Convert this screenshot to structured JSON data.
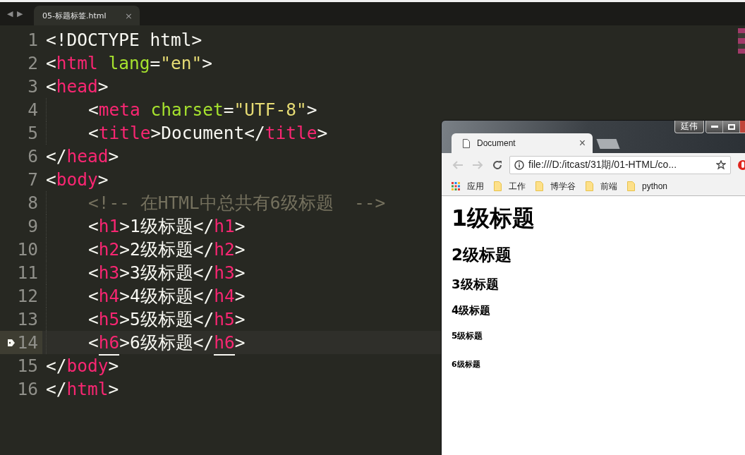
{
  "editor": {
    "nav": [
      "◀",
      "▶"
    ],
    "tabs": [
      {
        "label": "05-标题标签.html",
        "selected": true,
        "close": "×"
      }
    ],
    "lines": [
      {
        "number": "1",
        "indent": false,
        "current": false,
        "tokens": [
          {
            "t": "<!DOCTYPE html>",
            "kind": "text"
          }
        ]
      },
      {
        "number": "2",
        "indent": false,
        "current": false,
        "tokens": [
          {
            "t": "<",
            "kind": "text"
          },
          {
            "t": "html",
            "kind": "tag"
          },
          {
            "t": " lang",
            "kind": "attr"
          },
          {
            "t": "=",
            "kind": "text"
          },
          {
            "t": "\"en\"",
            "kind": "string"
          },
          {
            "t": ">",
            "kind": "text"
          }
        ]
      },
      {
        "number": "3",
        "indent": false,
        "current": false,
        "tokens": [
          {
            "t": "<",
            "kind": "text"
          },
          {
            "t": "head",
            "kind": "tag"
          },
          {
            "t": ">",
            "kind": "text"
          }
        ]
      },
      {
        "number": "4",
        "indent": true,
        "current": false,
        "tokens": [
          {
            "t": "<",
            "kind": "text"
          },
          {
            "t": "meta",
            "kind": "tag"
          },
          {
            "t": " charset",
            "kind": "attr"
          },
          {
            "t": "=",
            "kind": "text"
          },
          {
            "t": "\"UTF-8\"",
            "kind": "string"
          },
          {
            "t": ">",
            "kind": "text"
          }
        ]
      },
      {
        "number": "5",
        "indent": true,
        "current": false,
        "tokens": [
          {
            "t": "<",
            "kind": "text"
          },
          {
            "t": "title",
            "kind": "tag"
          },
          {
            "t": ">Document</",
            "kind": "text"
          },
          {
            "t": "title",
            "kind": "tag"
          },
          {
            "t": ">",
            "kind": "text"
          }
        ]
      },
      {
        "number": "6",
        "indent": false,
        "current": false,
        "tokens": [
          {
            "t": "</",
            "kind": "text"
          },
          {
            "t": "head",
            "kind": "tag"
          },
          {
            "t": ">",
            "kind": "text"
          }
        ]
      },
      {
        "number": "7",
        "indent": false,
        "current": false,
        "tokens": [
          {
            "t": "<",
            "kind": "text"
          },
          {
            "t": "body",
            "kind": "tag"
          },
          {
            "t": ">",
            "kind": "text"
          }
        ]
      },
      {
        "number": "8",
        "indent": true,
        "current": false,
        "tokens": [
          {
            "t": "<!-- 在HTML中总共有6级标题  -->",
            "kind": "comment"
          }
        ]
      },
      {
        "number": "9",
        "indent": true,
        "current": false,
        "tokens": [
          {
            "t": "<",
            "kind": "text"
          },
          {
            "t": "h1",
            "kind": "tag"
          },
          {
            "t": ">1级标题</",
            "kind": "text"
          },
          {
            "t": "h1",
            "kind": "tag"
          },
          {
            "t": ">",
            "kind": "text"
          }
        ]
      },
      {
        "number": "10",
        "indent": true,
        "current": false,
        "tokens": [
          {
            "t": "<",
            "kind": "text"
          },
          {
            "t": "h2",
            "kind": "tag"
          },
          {
            "t": ">2级标题</",
            "kind": "text"
          },
          {
            "t": "h2",
            "kind": "tag"
          },
          {
            "t": ">",
            "kind": "text"
          }
        ]
      },
      {
        "number": "11",
        "indent": true,
        "current": false,
        "tokens": [
          {
            "t": "<",
            "kind": "text"
          },
          {
            "t": "h3",
            "kind": "tag"
          },
          {
            "t": ">3级标题</",
            "kind": "text"
          },
          {
            "t": "h3",
            "kind": "tag"
          },
          {
            "t": ">",
            "kind": "text"
          }
        ]
      },
      {
        "number": "12",
        "indent": true,
        "current": false,
        "tokens": [
          {
            "t": "<",
            "kind": "text"
          },
          {
            "t": "h4",
            "kind": "tag"
          },
          {
            "t": ">4级标题</",
            "kind": "text"
          },
          {
            "t": "h4",
            "kind": "tag"
          },
          {
            "t": ">",
            "kind": "text"
          }
        ]
      },
      {
        "number": "13",
        "indent": true,
        "current": false,
        "tokens": [
          {
            "t": "<",
            "kind": "text"
          },
          {
            "t": "h5",
            "kind": "tag"
          },
          {
            "t": ">5级标题</",
            "kind": "text"
          },
          {
            "t": "h5",
            "kind": "tag"
          },
          {
            "t": ">",
            "kind": "text"
          }
        ]
      },
      {
        "number": "14",
        "indent": true,
        "current": true,
        "tokens": [
          {
            "t": "<",
            "kind": "text"
          },
          {
            "t": "h6",
            "kind": "matched"
          },
          {
            "t": ">6级标题</",
            "kind": "text"
          },
          {
            "t": "h6",
            "kind": "matched"
          },
          {
            "t": ">",
            "kind": "text"
          }
        ]
      },
      {
        "number": "15",
        "indent": false,
        "current": false,
        "tokens": [
          {
            "t": "</",
            "kind": "text"
          },
          {
            "t": "body",
            "kind": "tag"
          },
          {
            "t": ">",
            "kind": "text"
          }
        ]
      },
      {
        "number": "16",
        "indent": false,
        "current": false,
        "tokens": [
          {
            "t": "</",
            "kind": "text"
          },
          {
            "t": "html",
            "kind": "tag"
          },
          {
            "t": ">",
            "kind": "text"
          }
        ]
      }
    ]
  },
  "browser": {
    "user_badge": "廷伟",
    "tabs": [
      {
        "title": "Document",
        "selected": true,
        "close": "×"
      }
    ],
    "address": "file:///D:/itcast/31期/01-HTML/co...",
    "bookmarks": [
      {
        "label": "应用",
        "kind": "apps"
      },
      {
        "label": "工作",
        "kind": "folder"
      },
      {
        "label": "博学谷",
        "kind": "folder"
      },
      {
        "label": "前端",
        "kind": "folder"
      },
      {
        "label": "python",
        "kind": "folder"
      }
    ],
    "headings": [
      {
        "kind": "h1",
        "text": "1级标题"
      },
      {
        "kind": "h2",
        "text": "2级标题"
      },
      {
        "kind": "h3",
        "text": "3级标题"
      },
      {
        "kind": "h4",
        "text": "4级标题"
      },
      {
        "kind": "h5",
        "text": "5级标题"
      },
      {
        "kind": "h6",
        "text": "6级标题"
      }
    ]
  }
}
